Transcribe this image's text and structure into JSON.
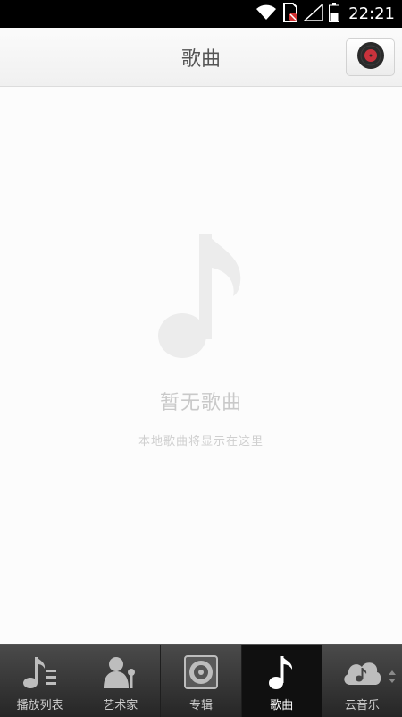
{
  "status_bar": {
    "time": "22:21"
  },
  "header": {
    "title": "歌曲"
  },
  "empty_state": {
    "title": "暂无歌曲",
    "subtitle": "本地歌曲将显示在这里"
  },
  "tabs": [
    {
      "label": "播放列表",
      "icon": "playlist-icon",
      "active": false
    },
    {
      "label": "艺术家",
      "icon": "artist-icon",
      "active": false
    },
    {
      "label": "专辑",
      "icon": "album-icon",
      "active": false
    },
    {
      "label": "歌曲",
      "icon": "music-note-icon",
      "active": true
    },
    {
      "label": "云音乐",
      "icon": "cloud-music-icon",
      "active": false
    }
  ],
  "colors": {
    "accent_record": "#c8323c",
    "tab_bar": "#333333",
    "active_tab": "#101010"
  }
}
